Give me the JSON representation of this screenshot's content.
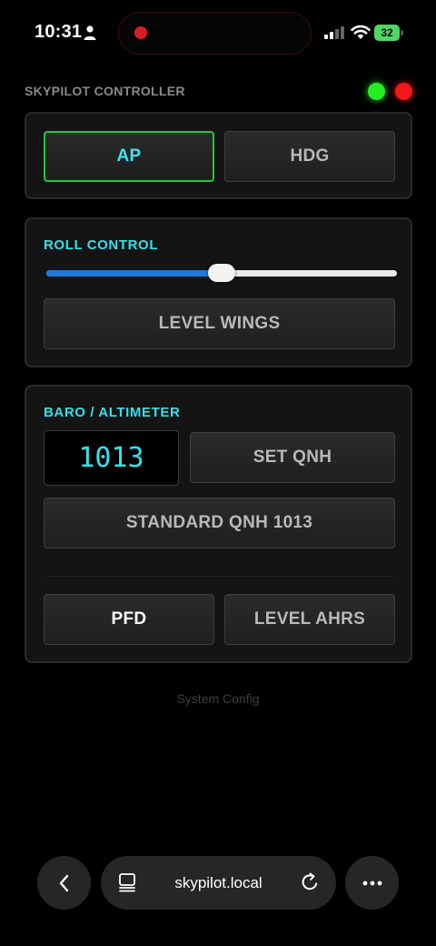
{
  "status_bar": {
    "time": "10:31",
    "battery": "32"
  },
  "header": {
    "title": "SKYPILOT CONTROLLER"
  },
  "mode_panel": {
    "ap_label": "AP",
    "hdg_label": "HDG"
  },
  "roll_panel": {
    "title": "ROLL CONTROL",
    "slider_value_fraction": 0.5,
    "level_wings_label": "LEVEL WINGS"
  },
  "baro_panel": {
    "title": "BARO / ALTIMETER",
    "qnh_value": "1013",
    "set_qnh_label": "SET QNH",
    "standard_qnh_label": "STANDARD QNH 1013",
    "pfd_label": "PFD",
    "level_ahrs_label": "LEVEL AHRS"
  },
  "footer": {
    "system_config_label": "System Config"
  },
  "browser": {
    "url": "skypilot.local"
  },
  "colors": {
    "accent_cyan": "#34e0ec",
    "active_border": "#23c83a",
    "led_green": "#22ee22",
    "led_red": "#f21818",
    "slider_fill": "#1f77d8"
  }
}
